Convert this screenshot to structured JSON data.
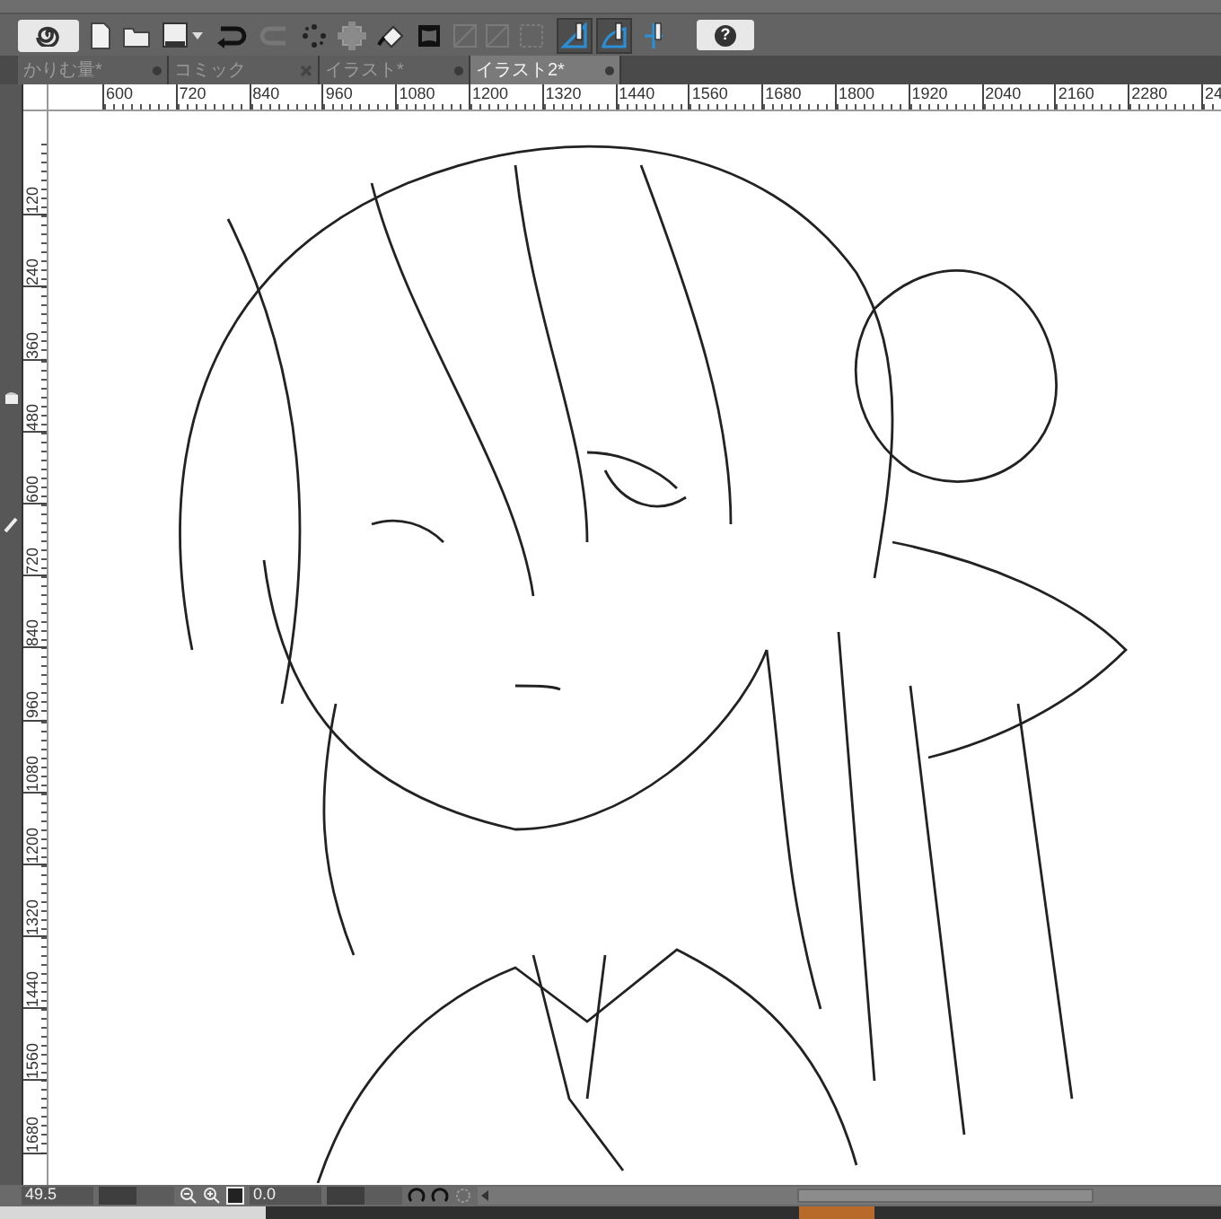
{
  "toolbar": {
    "snap_buttons": [
      {
        "pressed": true
      },
      {
        "pressed": true
      },
      {
        "pressed": false
      }
    ],
    "help_label": "?"
  },
  "tabs": [
    {
      "label": "かりむ量*",
      "selected": false,
      "modified": true
    },
    {
      "label": "コミック",
      "selected": false,
      "modified": false
    },
    {
      "label": "イラスト*",
      "selected": false,
      "modified": true
    },
    {
      "label": "イラスト2*",
      "selected": true,
      "modified": true
    }
  ],
  "ruler": {
    "horizontal": [
      "600",
      "720",
      "840",
      "960",
      "1080",
      "1200",
      "1320",
      "1440",
      "1560",
      "1680",
      "1800",
      "1920",
      "2040",
      "2160",
      "2280",
      "24"
    ],
    "vertical": [
      "120",
      "240",
      "360",
      "480",
      "600",
      "720",
      "840",
      "960",
      "1080",
      "1200",
      "1320",
      "1440",
      "1560",
      "1680"
    ]
  },
  "status_bar": {
    "zoom": "49.5",
    "zoom_slider": {
      "level": 0.5
    },
    "rotation": "0.0",
    "rotation_slider": {
      "level": 0.5
    }
  }
}
